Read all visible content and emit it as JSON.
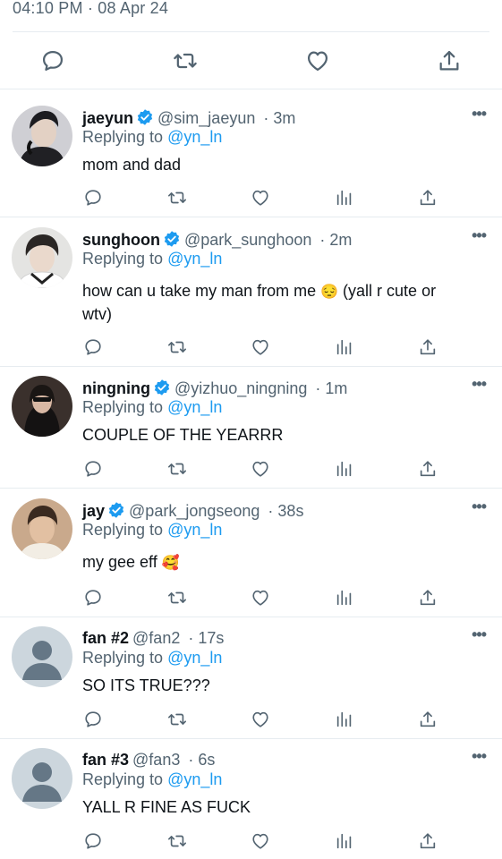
{
  "tweet": {
    "timestamp": "04:10 PM · 08 Apr 24"
  },
  "main_actions": [
    "reply-icon",
    "retweet-icon",
    "like-icon",
    "share-icon"
  ],
  "reply_actions": [
    "reply-icon",
    "retweet-icon",
    "like-icon",
    "views-icon",
    "share-icon"
  ],
  "colors": {
    "accent": "#1d9bf0",
    "muted": "#536471",
    "text": "#0f1419",
    "divider": "#e6ecf0"
  },
  "replies": [
    {
      "name": "jaeyun",
      "verified": true,
      "handle": "@sim_jaeyun",
      "time": "· 3m",
      "replying_label": "Replying to",
      "replying_to": "@yn_ln",
      "text": "mom and dad",
      "emoji": "",
      "more": "•••"
    },
    {
      "name": "sunghoon",
      "verified": true,
      "handle": "@park_sunghoon",
      "time": "· 2m",
      "replying_label": "Replying to",
      "replying_to": "@yn_ln",
      "text_line1": "how can u take my man from me",
      "emoji": "😔",
      "text_line1b": " (yall r cute or",
      "text_line2": "wtv)",
      "more": "•••"
    },
    {
      "name": "ningning",
      "verified": true,
      "handle": "@yizhuo_ningning",
      "time": "· 1m",
      "replying_label": "Replying to",
      "replying_to": "@yn_ln",
      "text": "COUPLE OF THE YEARRR",
      "emoji": "",
      "more": "•••"
    },
    {
      "name": "jay",
      "verified": true,
      "handle": "@park_jongseong",
      "time": "· 38s",
      "replying_label": "Replying to",
      "replying_to": "@yn_ln",
      "text": "my gee eff",
      "emoji": "🥰",
      "more": "•••"
    },
    {
      "name": "fan #2",
      "verified": false,
      "handle": "@fan2",
      "time": "· 17s",
      "replying_label": "Replying to",
      "replying_to": "@yn_ln",
      "text": "SO ITS TRUE???",
      "emoji": "",
      "more": "•••"
    },
    {
      "name": "fan #3",
      "verified": false,
      "handle": "@fan3",
      "time": "· 6s",
      "replying_label": "Replying to",
      "replying_to": "@yn_ln",
      "text": "YALL R FINE AS FUCK",
      "emoji": "",
      "more": "•••"
    }
  ]
}
